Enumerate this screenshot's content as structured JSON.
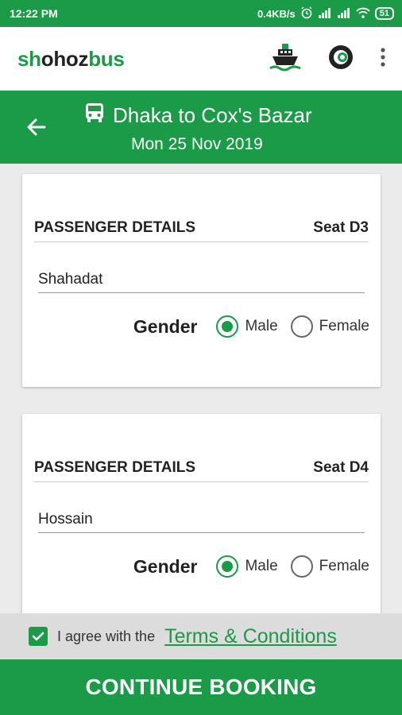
{
  "status_bar": {
    "time": "12:22 PM",
    "network_speed": "0.4KB/s",
    "battery": "51",
    "icons": [
      "alarm-icon",
      "signal-icon",
      "signal-icon",
      "wifi-icon",
      "battery-icon"
    ]
  },
  "app_bar": {
    "logo_prefix": "sh",
    "logo_o": "o",
    "logo_mid": "hoz",
    "logo_suffix": "bus",
    "icons": [
      "ship-icon",
      "app-switch-icon",
      "more-vert-icon"
    ]
  },
  "trip": {
    "title": "Dhaka to Cox's Bazar",
    "date": "Mon 25 Nov 2019",
    "icon": "bus-icon"
  },
  "passengers": [
    {
      "heading": "PASSENGER DETAILS",
      "seat": "Seat D3",
      "name": "Shahadat",
      "gender_label": "Gender",
      "options": [
        "Male",
        "Female"
      ],
      "selected": "Male"
    },
    {
      "heading": "PASSENGER DETAILS",
      "seat": "Seat D4",
      "name": "Hossain",
      "gender_label": "Gender",
      "options": [
        "Male",
        "Female"
      ],
      "selected": "Male"
    }
  ],
  "agreement": {
    "text": "I agree with the",
    "link": "Terms & Conditions",
    "checked": true
  },
  "cta": {
    "label": "CONTINUE BOOKING"
  },
  "colors": {
    "brand_green": "#1b9a47",
    "background": "#ebebeb"
  }
}
